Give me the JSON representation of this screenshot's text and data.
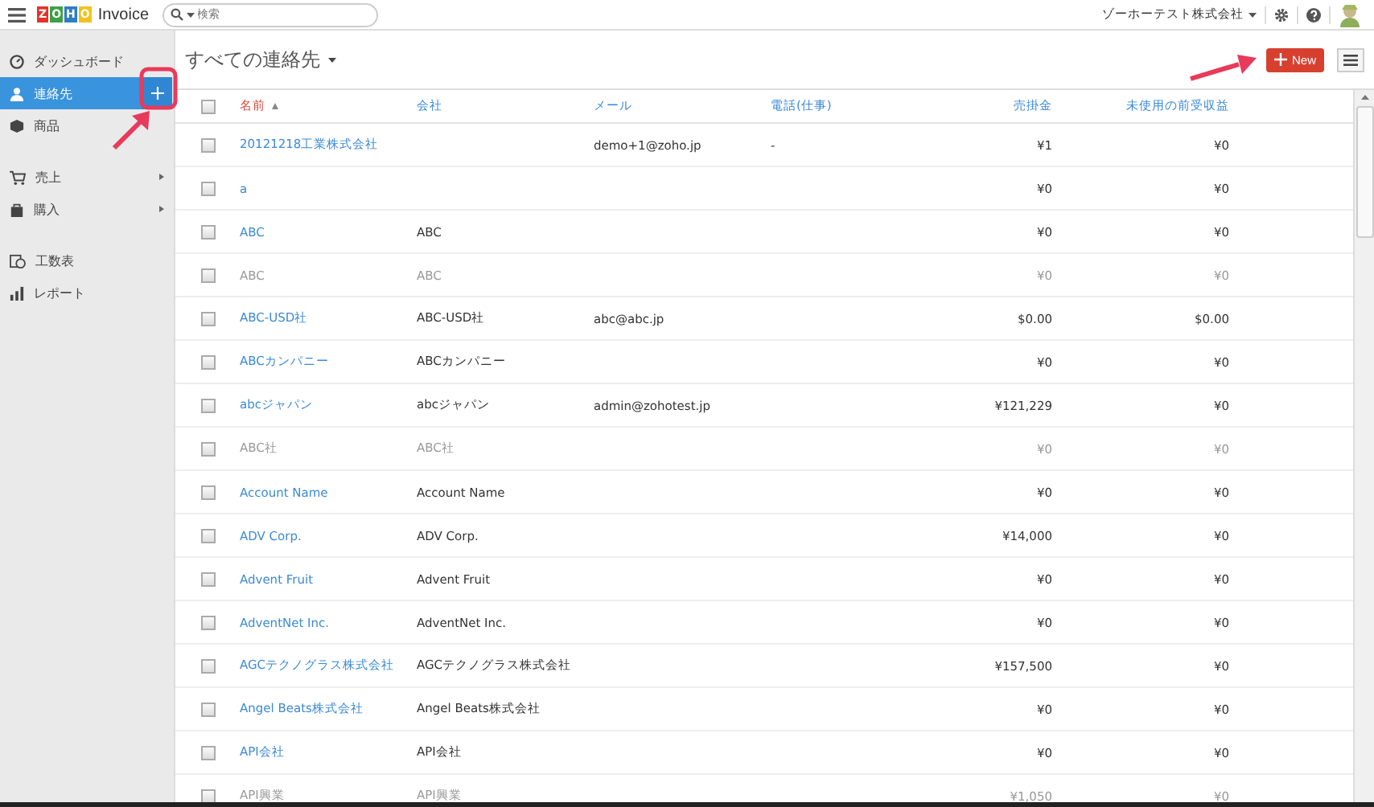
{
  "app": {
    "logo_letters": [
      {
        "char": "Z",
        "color": "#e4322b"
      },
      {
        "char": "O",
        "color": "#3ea045"
      },
      {
        "char": "H",
        "color": "#2d7ec4"
      },
      {
        "char": "O",
        "color": "#f2c21b"
      }
    ],
    "name": "Invoice"
  },
  "search": {
    "placeholder": "検索"
  },
  "org": {
    "name": "ゾーホーテスト株式会社"
  },
  "sidebar": {
    "groups": [
      [
        {
          "label": "ダッシュボード",
          "selected": false,
          "submenu": false
        },
        {
          "label": "連絡先",
          "selected": true,
          "submenu": false
        },
        {
          "label": "商品",
          "selected": false,
          "submenu": false
        }
      ],
      [
        {
          "label": "売上",
          "selected": false,
          "submenu": true
        },
        {
          "label": "購入",
          "selected": false,
          "submenu": true
        }
      ],
      [
        {
          "label": "工数表",
          "selected": false,
          "submenu": false
        },
        {
          "label": "レポート",
          "selected": false,
          "submenu": false
        }
      ]
    ]
  },
  "page": {
    "title": "すべての連絡先",
    "new_button": "New"
  },
  "table": {
    "all_checked": false,
    "columns": [
      {
        "label": "名前",
        "sorted": true
      },
      {
        "label": "会社",
        "sorted": false
      },
      {
        "label": "メール",
        "sorted": false
      },
      {
        "label": "電話(仕事)",
        "sorted": false
      },
      {
        "label": "売掛金",
        "sorted": false
      },
      {
        "label": "未使用の前受収益",
        "sorted": false
      }
    ],
    "rows": [
      {
        "name": "20121218工業株式会社",
        "company": "",
        "email": "demo+1@zoho.jp",
        "phone": "-",
        "receivable": "¥1",
        "unused": "¥0",
        "active": true,
        "checked": false
      },
      {
        "name": "a",
        "company": "",
        "email": "",
        "phone": "",
        "receivable": "¥0",
        "unused": "¥0",
        "active": true,
        "checked": false
      },
      {
        "name": "ABC",
        "company": "ABC",
        "email": "",
        "phone": "",
        "receivable": "¥0",
        "unused": "¥0",
        "active": true,
        "checked": false
      },
      {
        "name": "ABC",
        "company": "ABC",
        "email": "",
        "phone": "",
        "receivable": "¥0",
        "unused": "¥0",
        "active": false,
        "checked": false
      },
      {
        "name": "ABC-USD社",
        "company": "ABC-USD社",
        "email": "abc@abc.jp",
        "phone": "",
        "receivable": "$0.00",
        "unused": "$0.00",
        "active": true,
        "checked": false
      },
      {
        "name": "ABCカンパニー",
        "company": "ABCカンパニー",
        "email": "",
        "phone": "",
        "receivable": "¥0",
        "unused": "¥0",
        "active": true,
        "checked": false
      },
      {
        "name": "abcジャパン",
        "company": "abcジャパン",
        "email": "admin@zohotest.jp",
        "phone": "",
        "receivable": "¥121,229",
        "unused": "¥0",
        "active": true,
        "checked": false
      },
      {
        "name": "ABC社",
        "company": "ABC社",
        "email": "",
        "phone": "",
        "receivable": "¥0",
        "unused": "¥0",
        "active": false,
        "checked": false
      },
      {
        "name": "Account Name",
        "company": "Account Name",
        "email": "",
        "phone": "",
        "receivable": "¥0",
        "unused": "¥0",
        "active": true,
        "checked": false
      },
      {
        "name": "ADV Corp.",
        "company": "ADV Corp.",
        "email": "",
        "phone": "",
        "receivable": "¥14,000",
        "unused": "¥0",
        "active": true,
        "checked": false
      },
      {
        "name": "Advent Fruit",
        "company": "Advent Fruit",
        "email": "",
        "phone": "",
        "receivable": "¥0",
        "unused": "¥0",
        "active": true,
        "checked": false
      },
      {
        "name": "AdventNet Inc.",
        "company": "AdventNet Inc.",
        "email": "",
        "phone": "",
        "receivable": "¥0",
        "unused": "¥0",
        "active": true,
        "checked": false
      },
      {
        "name": "AGCテクノグラス株式会社",
        "company": "AGCテクノグラス株式会社",
        "email": "",
        "phone": "",
        "receivable": "¥157,500",
        "unused": "¥0",
        "active": true,
        "checked": false
      },
      {
        "name": "Angel Beats株式会社",
        "company": "Angel Beats株式会社",
        "email": "",
        "phone": "",
        "receivable": "¥0",
        "unused": "¥0",
        "active": true,
        "checked": false
      },
      {
        "name": "API会社",
        "company": "API会社",
        "email": "",
        "phone": "",
        "receivable": "¥0",
        "unused": "¥0",
        "active": true,
        "checked": false
      },
      {
        "name": "API興業",
        "company": "API興業",
        "email": "",
        "phone": "",
        "receivable": "¥1,050",
        "unused": "¥0",
        "active": false,
        "checked": false
      }
    ]
  }
}
